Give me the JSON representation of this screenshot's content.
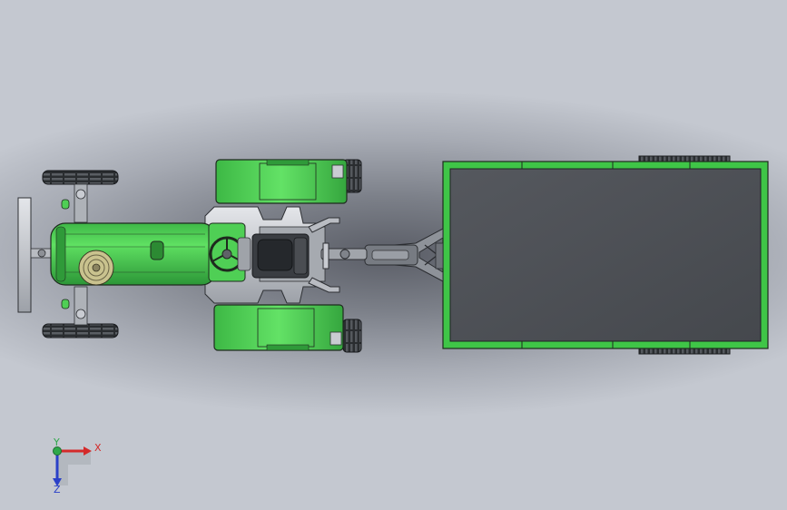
{
  "viewport": {
    "background_center": "#5a5d66",
    "background_edge": "#c4c8d0"
  },
  "model": {
    "body_color": "#4fcf55",
    "body_shade": "#2f9a39",
    "edge_color": "#1e2a1e",
    "steel_color": "#c9ccd2",
    "tire_color": "#2a2d30",
    "bed_color": "#4c4f55"
  },
  "triad": {
    "x_label": "X",
    "y_label": "Y",
    "z_label": "Z",
    "x_color": "#d42a2a",
    "y_color": "#2ea84a",
    "z_color": "#2a40c8"
  }
}
